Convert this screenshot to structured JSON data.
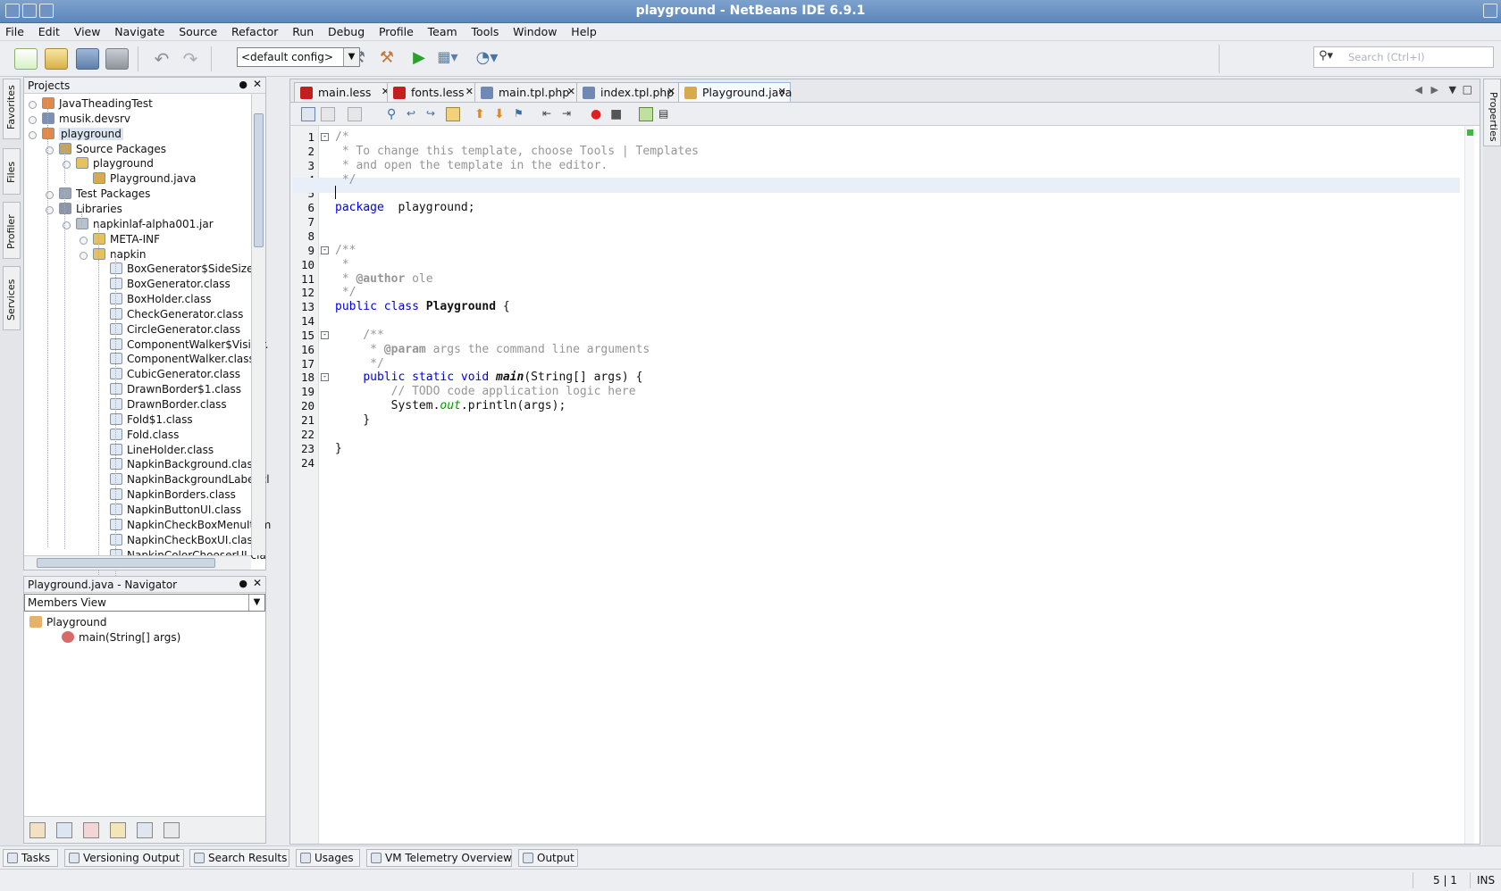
{
  "window": {
    "title": "playground - NetBeans IDE 6.9.1"
  },
  "menu": [
    "File",
    "Edit",
    "View",
    "Navigate",
    "Source",
    "Refactor",
    "Run",
    "Debug",
    "Profile",
    "Team",
    "Tools",
    "Window",
    "Help"
  ],
  "toolbar": {
    "config": "<default config>",
    "search_placeholder": "Search (Ctrl+I)"
  },
  "side_tabs": [
    "Favorites",
    "Files",
    "Profiler",
    "Services"
  ],
  "right_tabs": [
    "Properties"
  ],
  "projects": {
    "title": "Projects",
    "items": [
      {
        "label": "JavaTheadingTest",
        "icon": "java-project-icon"
      },
      {
        "label": "musik.devsrv",
        "icon": "php-project-icon"
      },
      {
        "label": "playground",
        "icon": "java-project-icon"
      },
      {
        "label": "Source Packages",
        "icon": "source-packages-icon"
      },
      {
        "label": "playground",
        "icon": "package-icon"
      },
      {
        "label": "Playground.java",
        "icon": "java-file-icon"
      },
      {
        "label": "Test Packages",
        "icon": "test-packages-icon"
      },
      {
        "label": "Libraries",
        "icon": "libraries-icon"
      },
      {
        "label": "napkinlaf-alpha001.jar",
        "icon": "jar-icon"
      },
      {
        "label": "META-INF",
        "icon": "package-icon"
      },
      {
        "label": "napkin",
        "icon": "package-icon"
      },
      {
        "label": "BoxGenerator$SideSize.cl",
        "icon": "class-file-icon"
      },
      {
        "label": "BoxGenerator.class",
        "icon": "class-file-icon"
      },
      {
        "label": "BoxHolder.class",
        "icon": "class-file-icon"
      },
      {
        "label": "CheckGenerator.class",
        "icon": "class-file-icon"
      },
      {
        "label": "CircleGenerator.class",
        "icon": "class-file-icon"
      },
      {
        "label": "ComponentWalker$Visitor.",
        "icon": "class-file-icon"
      },
      {
        "label": "ComponentWalker.class",
        "icon": "class-file-icon"
      },
      {
        "label": "CubicGenerator.class",
        "icon": "class-file-icon"
      },
      {
        "label": "DrawnBorder$1.class",
        "icon": "class-file-icon"
      },
      {
        "label": "DrawnBorder.class",
        "icon": "class-file-icon"
      },
      {
        "label": "Fold$1.class",
        "icon": "class-file-icon"
      },
      {
        "label": "Fold.class",
        "icon": "class-file-icon"
      },
      {
        "label": "LineHolder.class",
        "icon": "class-file-icon"
      },
      {
        "label": "NapkinBackground.class",
        "icon": "class-file-icon"
      },
      {
        "label": "NapkinBackgroundLabel.cl",
        "icon": "class-file-icon"
      },
      {
        "label": "NapkinBorders.class",
        "icon": "class-file-icon"
      },
      {
        "label": "NapkinButtonUI.class",
        "icon": "class-file-icon"
      },
      {
        "label": "NapkinCheckBoxMenuItem",
        "icon": "class-file-icon"
      },
      {
        "label": "NapkinCheckBoxUI.class",
        "icon": "class-file-icon"
      },
      {
        "label": "NapkinColorChooserUI.cla",
        "icon": "class-file-icon"
      }
    ]
  },
  "navigator": {
    "title": "Playground.java - Navigator",
    "view": "Members View",
    "items": [
      {
        "label": "Playground"
      },
      {
        "label": "main(String[] args)"
      }
    ]
  },
  "editor": {
    "tabs": [
      {
        "label": "main.less",
        "icon": "less-file-icon",
        "active": false
      },
      {
        "label": "fonts.less",
        "icon": "less-file-icon",
        "active": false
      },
      {
        "label": "main.tpl.php",
        "icon": "php-file-icon",
        "active": false
      },
      {
        "label": "index.tpl.php",
        "icon": "php-file-icon",
        "active": false
      },
      {
        "label": "Playground.java",
        "icon": "java-file-icon",
        "active": true
      }
    ],
    "lines": [
      [
        [
          "cm",
          "/*"
        ]
      ],
      [
        [
          "cm",
          " * To change this template, choose Tools | Templates"
        ]
      ],
      [
        [
          "cm",
          " * and open the template in the editor."
        ]
      ],
      [
        [
          "cm",
          " */"
        ]
      ],
      [],
      [
        [
          "kw",
          "package"
        ],
        [
          "",
          "  playground;"
        ]
      ],
      [],
      [],
      [
        [
          "cm",
          "/**"
        ]
      ],
      [
        [
          "cm",
          " *"
        ]
      ],
      [
        [
          "cm",
          " * "
        ],
        [
          "cm b",
          "@author"
        ],
        [
          "cm",
          " ole"
        ]
      ],
      [
        [
          "cm",
          " */"
        ]
      ],
      [
        [
          "kw",
          "public class"
        ],
        [
          "",
          " "
        ],
        [
          "b",
          "Playground"
        ],
        [
          "",
          " {"
        ]
      ],
      [],
      [
        [
          "cm",
          "    /**"
        ]
      ],
      [
        [
          "cm",
          "     * "
        ],
        [
          "cm b",
          "@param"
        ],
        [
          "cm",
          " args the command line arguments"
        ]
      ],
      [
        [
          "cm",
          "     */"
        ]
      ],
      [
        [
          "",
          "    "
        ],
        [
          "kw",
          "public static void"
        ],
        [
          "",
          " "
        ],
        [
          "b it",
          "main"
        ],
        [
          "",
          "(String[] args) {"
        ]
      ],
      [
        [
          "cm",
          "        // TODO code application logic here"
        ]
      ],
      [
        [
          "",
          "        System."
        ],
        [
          "grn it",
          "out"
        ],
        [
          "",
          ".println(args);"
        ]
      ],
      [
        [
          "",
          "    }"
        ]
      ],
      [],
      [
        [
          "",
          "}"
        ]
      ],
      []
    ]
  },
  "bottom_tabs": [
    "Tasks",
    "Versioning Output",
    "Search Results",
    "Usages",
    "VM Telemetry Overview",
    "Output"
  ],
  "status": {
    "position": "5 | 1",
    "mode": "INS"
  },
  "colors": {
    "keyword": "#0000e6",
    "comment": "#969696",
    "field": "#009900",
    "title_bar": "#6d93c4",
    "current_line": "#e9eff8"
  }
}
